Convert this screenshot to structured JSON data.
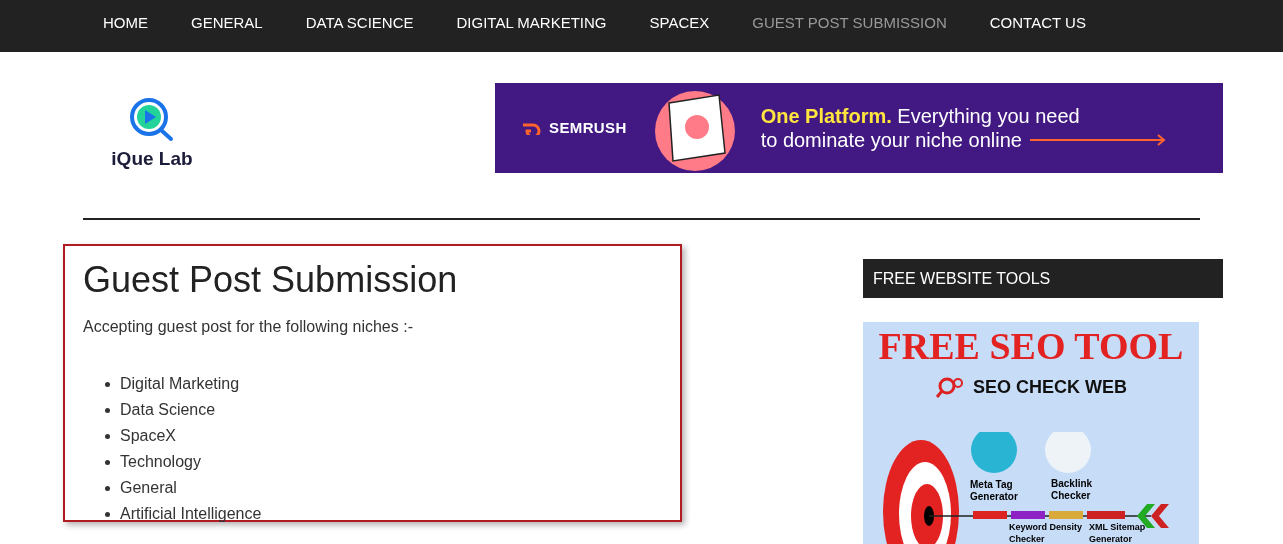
{
  "nav": [
    {
      "label": "HOME",
      "selected": false
    },
    {
      "label": "GENERAL",
      "selected": false
    },
    {
      "label": "DATA SCIENCE",
      "selected": false
    },
    {
      "label": "DIGITAL MARKETING",
      "selected": false
    },
    {
      "label": "SPACEX",
      "selected": false
    },
    {
      "label": "GUEST POST SUBMISSION",
      "selected": true
    },
    {
      "label": "CONTACT US",
      "selected": false
    }
  ],
  "logo": {
    "text": "iQue Lab"
  },
  "banner": {
    "brand": "SEMRUSH",
    "headline_bold": "One Platform.",
    "headline": "Everything you need",
    "headline_2": "to dominate your niche online"
  },
  "article": {
    "title": "Guest Post Submission",
    "intro": "Accepting guest post for the following niches :-",
    "niches": [
      "Digital Marketing",
      "Data Science",
      "SpaceX",
      "Technology",
      "General",
      "Artificial Intelligence"
    ]
  },
  "sidebar": {
    "title": "FREE WEBSITE TOOLS",
    "promo": {
      "headline": "FREE SEO TOOL",
      "brand": "SEO CHECK WEB",
      "labels": [
        "Meta Tag Generator",
        "Backlink Checker",
        "Keyword Density Checker",
        "XML Sitemap Generator"
      ]
    }
  }
}
